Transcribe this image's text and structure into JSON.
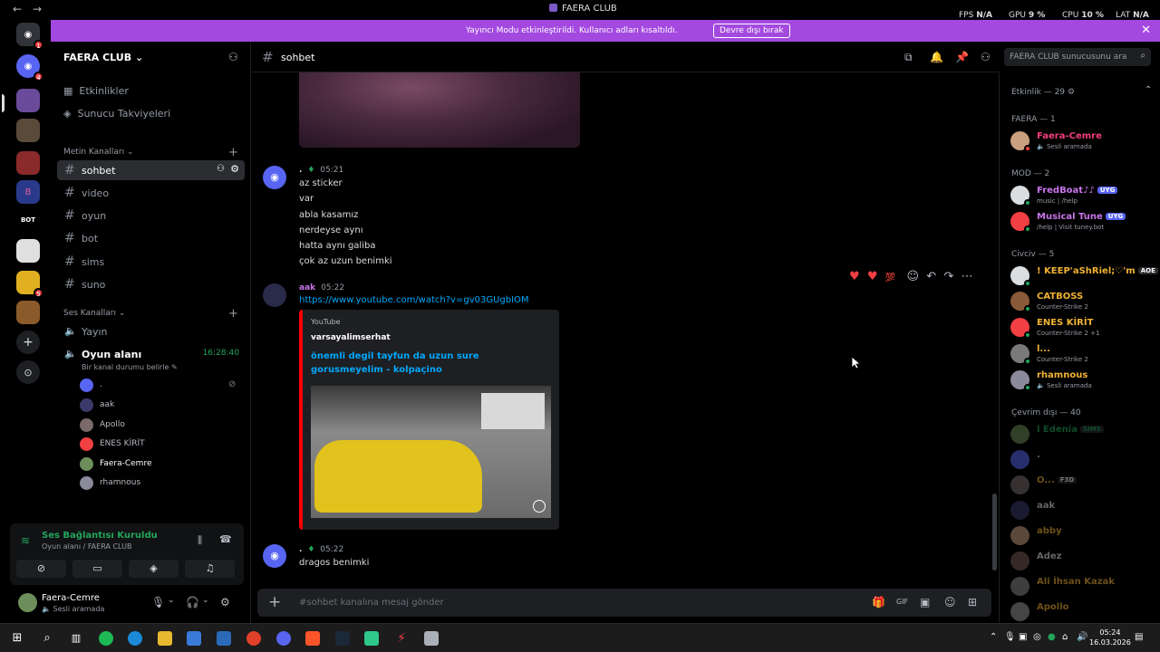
{
  "window": {
    "title": "FAERA CLUB",
    "back": "←",
    "forward": "→"
  },
  "perf": {
    "fps_label": "FPS",
    "fps_value": "N/A",
    "gpu_label": "GPU",
    "gpu_value": "9 %",
    "cpu_label": "CPU",
    "cpu_value": "10 %",
    "lat_label": "LAT",
    "lat_value": "N/A"
  },
  "banner": {
    "text": "Yayıncı Modu etkinleştirildi. Kullanıcı adları kısaltıldı.",
    "button": "Devre dışı bırak",
    "close": "✕"
  },
  "servers": {
    "badge1": "1",
    "badge2": "4",
    "badge3": "5",
    "badge4": "6",
    "bot_label": "BOT"
  },
  "sidebar": {
    "guild_name": "FAERA CLUB",
    "events": "Etkinlikler",
    "boosts": "Sunucu Takviyeleri",
    "text_category": "Metin Kanalları",
    "voice_category": "Ses Kanalları",
    "text_channels": [
      "sohbet",
      "video",
      "oyun",
      "bot",
      "sims",
      "suno"
    ],
    "voice_channels": {
      "yayin": "Yayın",
      "oyun_alani": "Oyun alanı",
      "timer": "16:28:40",
      "status_prompt": "Bir kanal durumu belirle"
    },
    "voice_users": [
      ".",
      "aak",
      "Apollo",
      "ENES KİRİT",
      "Faera-Cemre",
      "rhamnous"
    ]
  },
  "voice_status": {
    "title": "Ses Bağlantısı Kuruldu",
    "subtitle": "Oyun alanı / FAERA CLUB"
  },
  "user": {
    "name": "Faera-Cemre",
    "status": "Sesli aramada"
  },
  "header": {
    "channel": "sohbet",
    "search_placeholder": "FAERA CLUB sunucusunu ara"
  },
  "messages": {
    "m1": {
      "author": ".",
      "time": "05:21",
      "lines": [
        "az sticker",
        "var",
        "abla kasamız",
        "nerdeyse aynı",
        "hatta aynı galiba",
        "çok az uzun benimki"
      ]
    },
    "m2": {
      "author": "aak",
      "time": "05:22",
      "link": "https://www.youtube.com/watch?v=gv03GUgbIOM",
      "embed": {
        "provider": "YouTube",
        "author": "varsayalimserhat",
        "title": "önemli degil tayfun da uzun sure gorusmeyelim - kolpaçino"
      }
    },
    "m3": {
      "author": ".",
      "time": "05:22",
      "lines": [
        "dragos benimki"
      ]
    }
  },
  "composer": {
    "placeholder": "#sohbet kanalına mesaj gönder"
  },
  "members": {
    "activity_header": "Etkinlik — 29",
    "groups": [
      {
        "name": "FAERA — 1",
        "items": [
          {
            "name": "Faera-Cemre",
            "sub": "Sesli aramada",
            "color": "#f23f77"
          }
        ]
      },
      {
        "name": "MOD — 2",
        "items": [
          {
            "name": "FredBoat♪♪",
            "tag": "UYG",
            "sub": "music | /help",
            "color": "#c774e8"
          },
          {
            "name": "Musical Tune",
            "tag": "UYG",
            "sub": "/help | Visit tuney.bot",
            "color": "#c774e8"
          }
        ]
      },
      {
        "name": "Civciv — 5",
        "items": [
          {
            "name": "! KEEP'aShRiel;♡'m",
            "tag": "AOE",
            "sub": "",
            "color": "#f0b232"
          },
          {
            "name": "CATBOSS",
            "sub": "Counter-Strike 2",
            "color": "#f0b232"
          },
          {
            "name": "ENES KİRİT",
            "sub": "Counter-Strike 2 +1",
            "color": "#f0b232"
          },
          {
            "name": "l...",
            "sub": "Counter-Strike 2",
            "color": "#f0b232"
          },
          {
            "name": "rhamnous",
            "sub": "Sesli aramada",
            "color": "#f0b232"
          }
        ]
      },
      {
        "name": "Çevrim dışı — 40",
        "items": [
          {
            "name": "l Edenia",
            "tag": "SIMS",
            "sub": "",
            "color": "#23a55a"
          },
          {
            "name": ".",
            "sub": "",
            "color": "#dbdee1"
          },
          {
            "name": "O...",
            "tag": "F3D",
            "sub": "",
            "color": "#f0b232"
          },
          {
            "name": "aak",
            "sub": "",
            "color": "#dbdee1"
          },
          {
            "name": "abby",
            "sub": "",
            "color": "#f0b232"
          },
          {
            "name": "Adez",
            "sub": "",
            "color": "#dbdee1"
          },
          {
            "name": "Ali İhsan Kazak",
            "sub": "",
            "color": "#f0b232"
          },
          {
            "name": "Apollo",
            "sub": "",
            "color": "#f0b232"
          }
        ]
      }
    ]
  },
  "taskbar": {
    "time": "05:24",
    "date": "16.03.2026"
  },
  "colors": {
    "accent": "#5865f2",
    "banner": "#a449e0",
    "online": "#23a55a",
    "link": "#00a8fc"
  }
}
